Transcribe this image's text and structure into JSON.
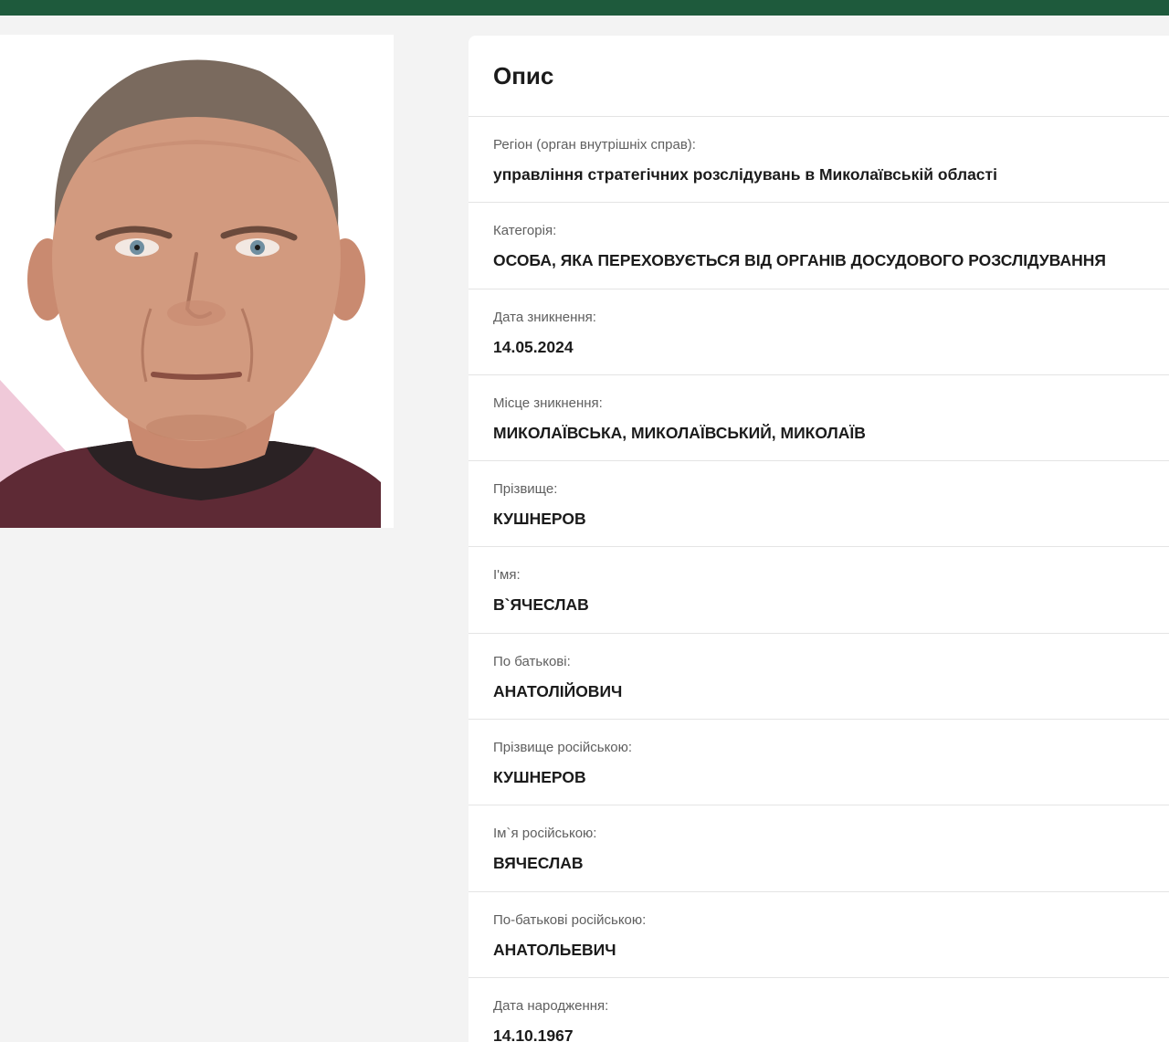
{
  "header": {
    "bar_color": "#1e5a3c"
  },
  "photo": {
    "alt": "Фото"
  },
  "details": {
    "title": "Опис",
    "fields": [
      {
        "label": "Регіон (орган внутрішніх справ):",
        "value": "управління стратегічних розслідувань в Миколаївській області"
      },
      {
        "label": "Категорія:",
        "value": "ОСОБА, ЯКА ПЕРЕХОВУЄТЬСЯ ВІД ОРГАНІВ ДОСУДОВОГО РОЗСЛІДУВАННЯ"
      },
      {
        "label": "Дата зникнення:",
        "value": "14.05.2024"
      },
      {
        "label": "Місце зникнення:",
        "value": "МИКОЛАЇВСЬКА, МИКОЛАЇВСЬКИЙ, МИКОЛАЇВ"
      },
      {
        "label": "Прізвище:",
        "value": "КУШНЕРОВ"
      },
      {
        "label": "І'мя:",
        "value": "В`ЯЧЕСЛАВ"
      },
      {
        "label": "По батькові:",
        "value": "АНАТОЛІЙОВИЧ"
      },
      {
        "label": "Прізвище російською:",
        "value": "КУШНЕРОВ"
      },
      {
        "label": "Ім`я російською:",
        "value": "ВЯЧЕСЛАВ"
      },
      {
        "label": "По-батькові російською:",
        "value": "АНАТОЛЬЕВИЧ"
      },
      {
        "label": "Дата народження:",
        "value": "14.10.1967"
      }
    ]
  }
}
